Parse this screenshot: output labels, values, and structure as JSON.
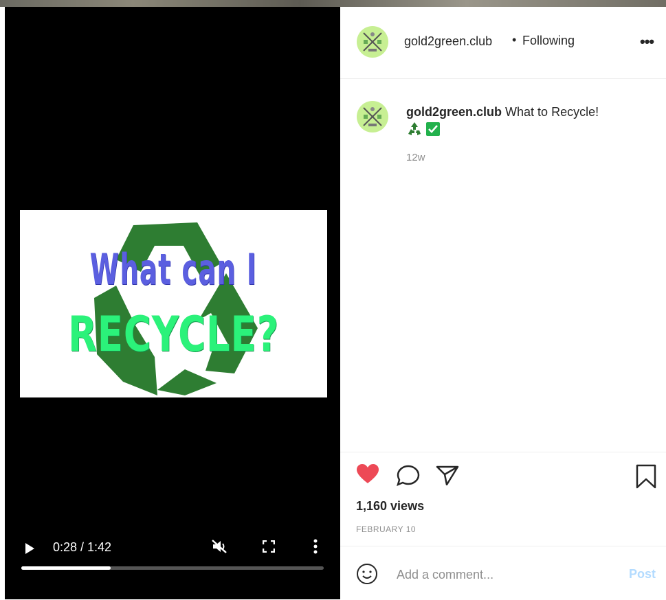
{
  "video": {
    "thumbnail_line1": "What can I",
    "thumbnail_line2": "RECYCLE?",
    "time_display": "0:28 / 1:42",
    "progress_fraction": 0.295,
    "icons": [
      "play-icon",
      "muted-speaker-icon",
      "fullscreen-icon",
      "more-vertical-icon"
    ]
  },
  "header": {
    "username": "gold2green.club",
    "separator": "•",
    "follow_status": "Following",
    "more_label": "•••"
  },
  "caption": {
    "username": "gold2green.club",
    "text": "What to Recycle!",
    "emojis": [
      "recycle-icon",
      "check-icon"
    ],
    "time_ago": "12w"
  },
  "actions": {
    "liked": true,
    "views": "1,160 views",
    "date": "FEBRUARY 10",
    "colors": {
      "heart": "#ed4956"
    }
  },
  "comment": {
    "placeholder": "Add a comment...",
    "post_label": "Post"
  }
}
